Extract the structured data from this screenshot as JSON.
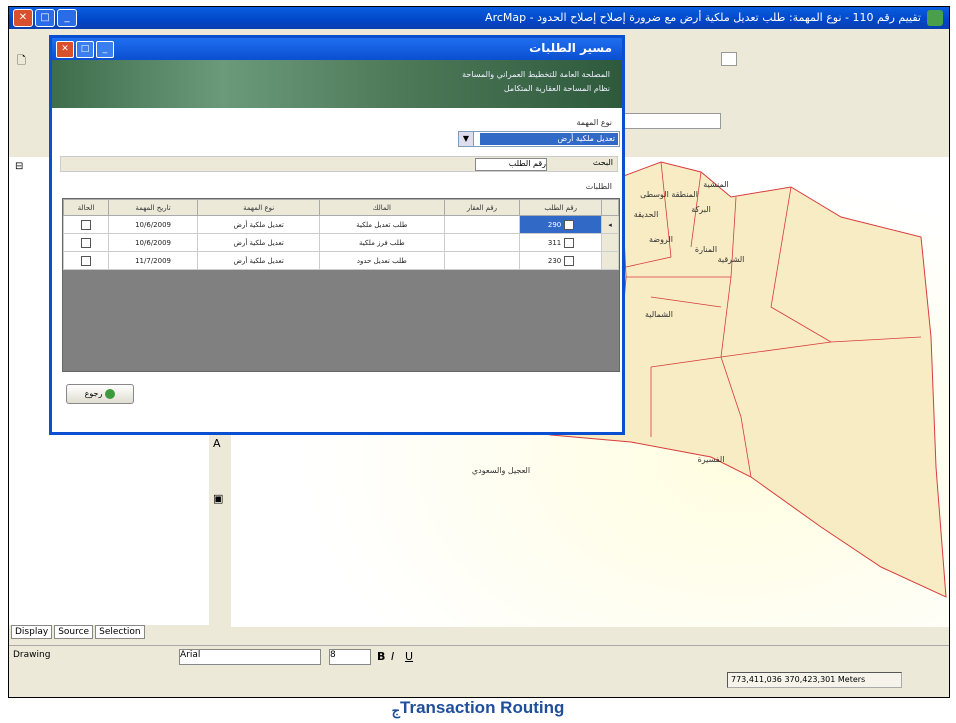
{
  "app": {
    "title": "تقييم رقم 110 - نوع المهمة: طلب تعديل ملكية أرض مع ضرورة إصلاح إصلاح الحدود - ArcMap"
  },
  "toolbar": {
    "drawing_label": "Drawing",
    "font_name": "Arial",
    "font_size": "8",
    "bold": "B",
    "italic": "I",
    "underline": "U"
  },
  "left_panel": {
    "tabs": [
      "Display",
      "Source",
      "Selection"
    ]
  },
  "dialog": {
    "title": "مسير الطلبات",
    "banner_line1": "المصلحة العامة للتخطيط العمراني والمساحة",
    "banner_line2": "نظام المساحة العقارية المتكامل",
    "type_label": "نوع المهمة",
    "type_value": "تعديل ملكية أرض",
    "search_label": "البحث",
    "search_hint": "رقم الطلب",
    "results_label": "الطلبات",
    "columns": [
      "رقم الطلب",
      "رقم العقار",
      "المالك",
      "نوع المهمة",
      "تاريخ المهمة",
      "الحالة"
    ],
    "rows": [
      {
        "num": "290",
        "owner": "طلب تعديل ملكية",
        "type": "تعديل ملكية أرض",
        "date": "10/6/2009"
      },
      {
        "num": "311",
        "owner": "طلب فرز ملكية",
        "type": "تعديل ملكية أرض",
        "date": "10/6/2009"
      },
      {
        "num": "230",
        "owner": "طلب تعديل حدود",
        "type": "تعديل ملكية أرض",
        "date": "11/7/2009"
      }
    ],
    "back_button": "رجوع"
  },
  "map": {
    "labels": [
      {
        "text": "المنطقة الوسطى"
      },
      {
        "text": "البركة"
      },
      {
        "text": "الحديقة"
      },
      {
        "text": "المنشية"
      },
      {
        "text": "الروضة"
      },
      {
        "text": "المنارة"
      },
      {
        "text": "الشرقية"
      },
      {
        "text": "الشمالية"
      },
      {
        "text": "العجيل والسعودي"
      },
      {
        "text": "الفسيرة"
      }
    ],
    "colors": {
      "fill": "#f7ecc4",
      "edge": "#d83c3c",
      "glow": "#fffde0"
    }
  },
  "status": {
    "coords": "773,411,036  370,423,301 Meters"
  },
  "caption": {
    "mark": "ج",
    "text": "Transaction Routing"
  }
}
